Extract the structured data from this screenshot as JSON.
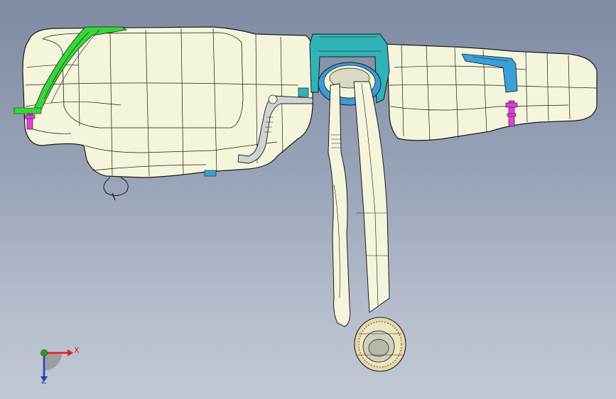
{
  "viewport": {
    "background_top": "#7f8ba3",
    "background_bottom": "#c2c8d4"
  },
  "model": {
    "body_fill": "#f5f5dc",
    "edge_color": "#1a1a1a",
    "strap_left_color": "#39d63a",
    "strap_right_color": "#3aa0d8",
    "pump_mount_color": "#2fb3b8",
    "bolt_color": "#e040d8",
    "hose_color": "#cfd3d6"
  },
  "triad": {
    "x_label": "X",
    "z_label": "Z",
    "x_color": "#e02020",
    "z_color": "#2040c0",
    "y_color": "#20a020"
  }
}
